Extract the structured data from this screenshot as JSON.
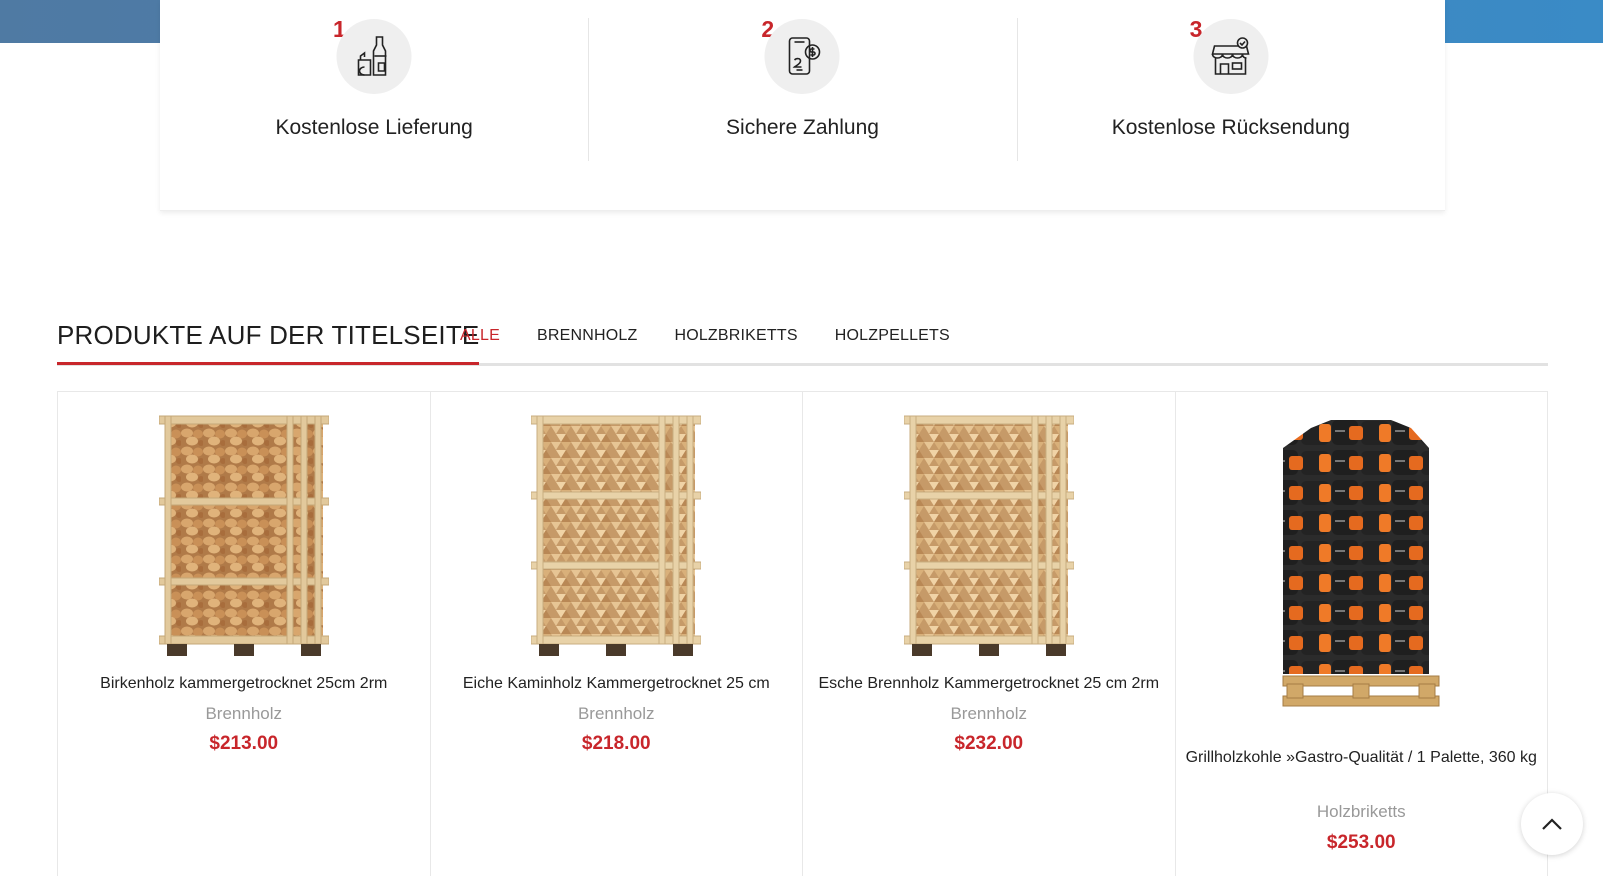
{
  "features": [
    {
      "num": "1.",
      "title": "Kostenlose Lieferung",
      "icon": "bottle-jar-icon"
    },
    {
      "num": "2.",
      "title": "Sichere Zahlung",
      "icon": "phone-payment-icon"
    },
    {
      "num": "3.",
      "title": "Kostenlose Rücksendung",
      "icon": "store-icon"
    }
  ],
  "products": {
    "heading": "PRODUKTE AUF DER TITELSEITE",
    "tabs": [
      "ALLE",
      "BRENNHOLZ",
      "HOLZBRIKETTS",
      "HOLZPELLETS"
    ],
    "active_tab": "ALLE",
    "items": [
      {
        "name": "Birkenholz kammergetrocknet 25cm 2rm",
        "category": "Brennholz",
        "price": "$213.00",
        "image": "firewood-pallet"
      },
      {
        "name": "Eiche Kaminholz Kammergetrocknet 25 cm",
        "category": "Brennholz",
        "price": "$218.00",
        "image": "firewood-pallet"
      },
      {
        "name": "Esche Brennholz Kammergetrocknet 25 cm 2rm",
        "category": "Brennholz",
        "price": "$232.00",
        "image": "firewood-pallet"
      },
      {
        "name": "Grillholzkohle »Gastro-Qualität / 1 Palette, 360 kg",
        "category": "Holzbriketts",
        "price": "$253.00",
        "image": "charcoal-bags-pallet"
      }
    ]
  },
  "colors": {
    "accent": "#c8262b",
    "band": "#4b7cab"
  },
  "scroll_top_icon": "chevron-up-icon"
}
